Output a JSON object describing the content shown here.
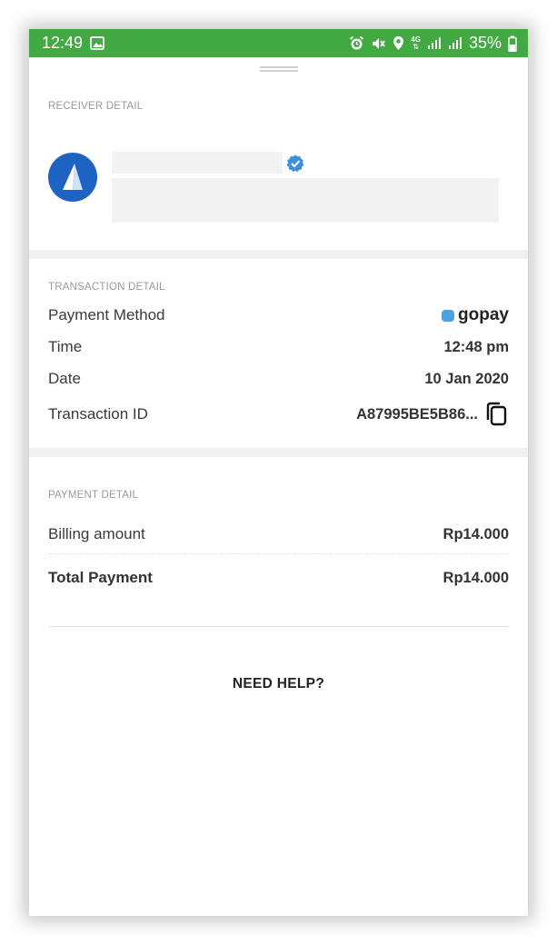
{
  "status_bar": {
    "time": "12:49",
    "network": "4G",
    "battery": "35%"
  },
  "receiver": {
    "section_label": "RECEIVER DETAIL"
  },
  "transaction": {
    "section_label": "TRANSACTION DETAIL",
    "payment_method_label": "Payment Method",
    "payment_method_value": "gopay",
    "time_label": "Time",
    "time_value": "12:48 pm",
    "date_label": "Date",
    "date_value": "10 Jan 2020",
    "id_label": "Transaction ID",
    "id_value": "A87995BE5B86..."
  },
  "payment": {
    "section_label": "PAYMENT DETAIL",
    "billing_label": "Billing amount",
    "billing_value": "Rp14.000",
    "total_label": "Total Payment",
    "total_value": "Rp14.000"
  },
  "help_label": "NEED HELP?",
  "colors": {
    "status_bar": "#43a943",
    "avatar": "#1e62c4",
    "verified": "#3d8fe0",
    "gopay": "#4aa3e0"
  }
}
